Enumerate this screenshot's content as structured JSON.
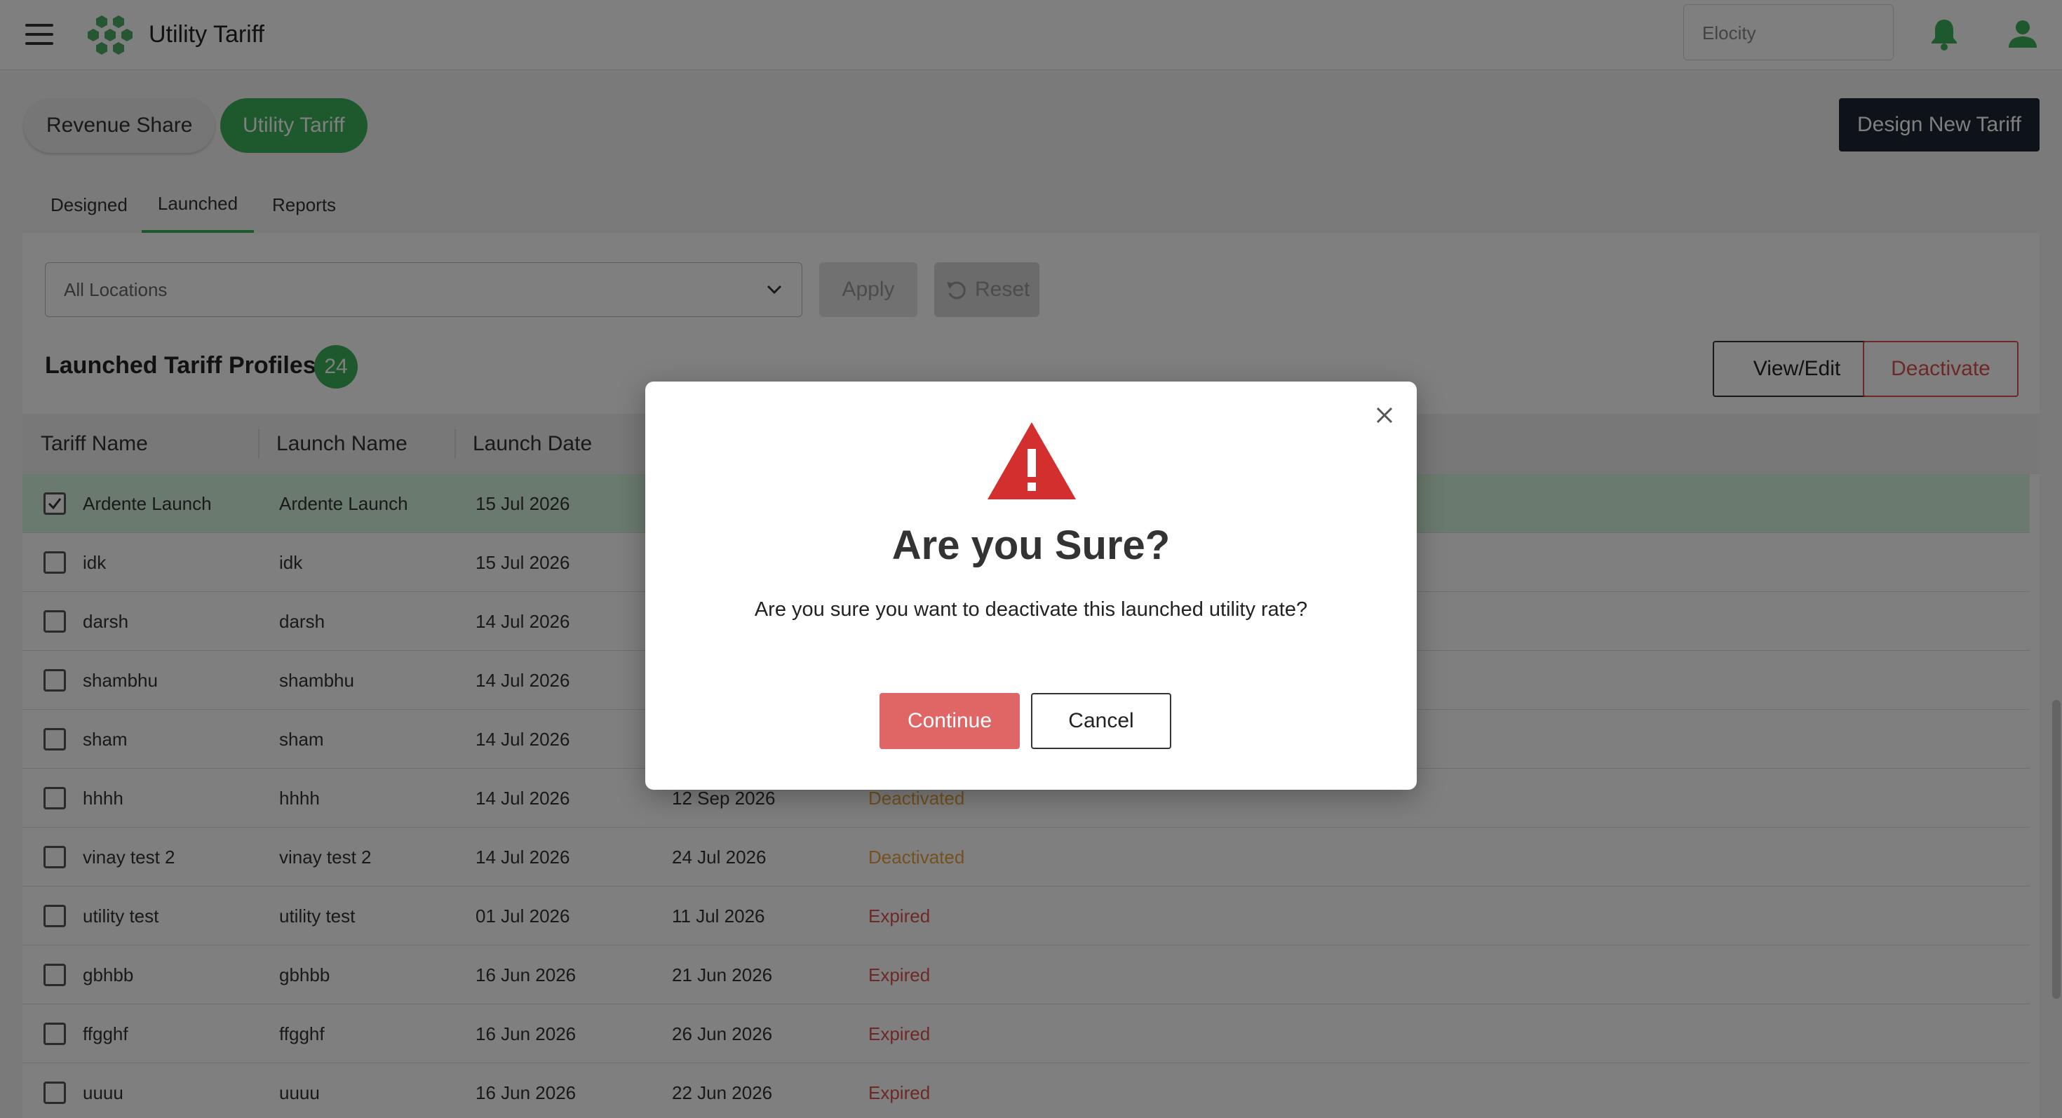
{
  "header": {
    "menu_icon": "hamburger-menu-icon",
    "logo_icon": "hexagon-cluster-logo",
    "title": "Utility Tariff",
    "org_placeholder": "Elocity",
    "bell_icon": "bell-icon",
    "user_icon": "user-icon",
    "accent_color": "#3cb05a"
  },
  "toolbar": {
    "revenue_share_label": "Revenue Share",
    "utility_tariff_label": "Utility Tariff",
    "design_new_label": "Design New Tariff"
  },
  "tabs": [
    {
      "label": "Designed"
    },
    {
      "label": "Launched",
      "active": true
    },
    {
      "label": "Reports"
    }
  ],
  "filters": {
    "location_value": "All Locations",
    "apply_label": "Apply",
    "reset_label": "Reset"
  },
  "section": {
    "title": "Launched Tariff Profiles",
    "count": "24",
    "view_edit_label": "View/Edit",
    "deactivate_label": "Deactivate"
  },
  "table": {
    "columns": [
      "Tariff Name",
      "Launch Name",
      "Launch Date"
    ],
    "rows": [
      {
        "tariff": "Ardente Launch",
        "launch": "Ardente Launch",
        "date": "15 Jul 2026",
        "end": "",
        "status": "",
        "selected": true
      },
      {
        "tariff": "idk",
        "launch": "idk",
        "date": "15 Jul 2026",
        "end": "",
        "status": ""
      },
      {
        "tariff": "darsh",
        "launch": "darsh",
        "date": "14 Jul 2026",
        "end": "",
        "status": ""
      },
      {
        "tariff": "shambhu",
        "launch": "shambhu",
        "date": "14 Jul 2026",
        "end": "",
        "status": ""
      },
      {
        "tariff": "sham",
        "launch": "sham",
        "date": "14 Jul 2026",
        "end": "",
        "status": ""
      },
      {
        "tariff": "hhhh",
        "launch": "hhhh",
        "date": "14 Jul 2026",
        "end": "12 Sep 2026",
        "status": "Deactivated"
      },
      {
        "tariff": "vinay test 2",
        "launch": "vinay test 2",
        "date": "14 Jul 2026",
        "end": "24 Jul 2026",
        "status": "Deactivated"
      },
      {
        "tariff": "utility test",
        "launch": "utility test",
        "date": "01 Jul 2026",
        "end": "11 Jul 2026",
        "status": "Expired"
      },
      {
        "tariff": "gbhbb",
        "launch": "gbhbb",
        "date": "16 Jun 2026",
        "end": "21 Jun 2026",
        "status": "Expired"
      },
      {
        "tariff": "ffgghf",
        "launch": "ffgghf",
        "date": "16 Jun 2026",
        "end": "26 Jun 2026",
        "status": "Expired"
      },
      {
        "tariff": "uuuu",
        "launch": "uuuu",
        "date": "16 Jun 2026",
        "end": "22 Jun 2026",
        "status": "Expired"
      }
    ],
    "status_colors": {
      "Deactivated": "#e8a33c",
      "Expired": "#d9534f"
    }
  },
  "modal": {
    "title": "Are you Sure?",
    "message": "Are you sure you want to deactivate this launched utility rate?",
    "continue_label": "Continue",
    "cancel_label": "Cancel",
    "icon": "warning-triangle-icon",
    "close_icon": "close-icon",
    "warning_color": "#d32f2f"
  }
}
